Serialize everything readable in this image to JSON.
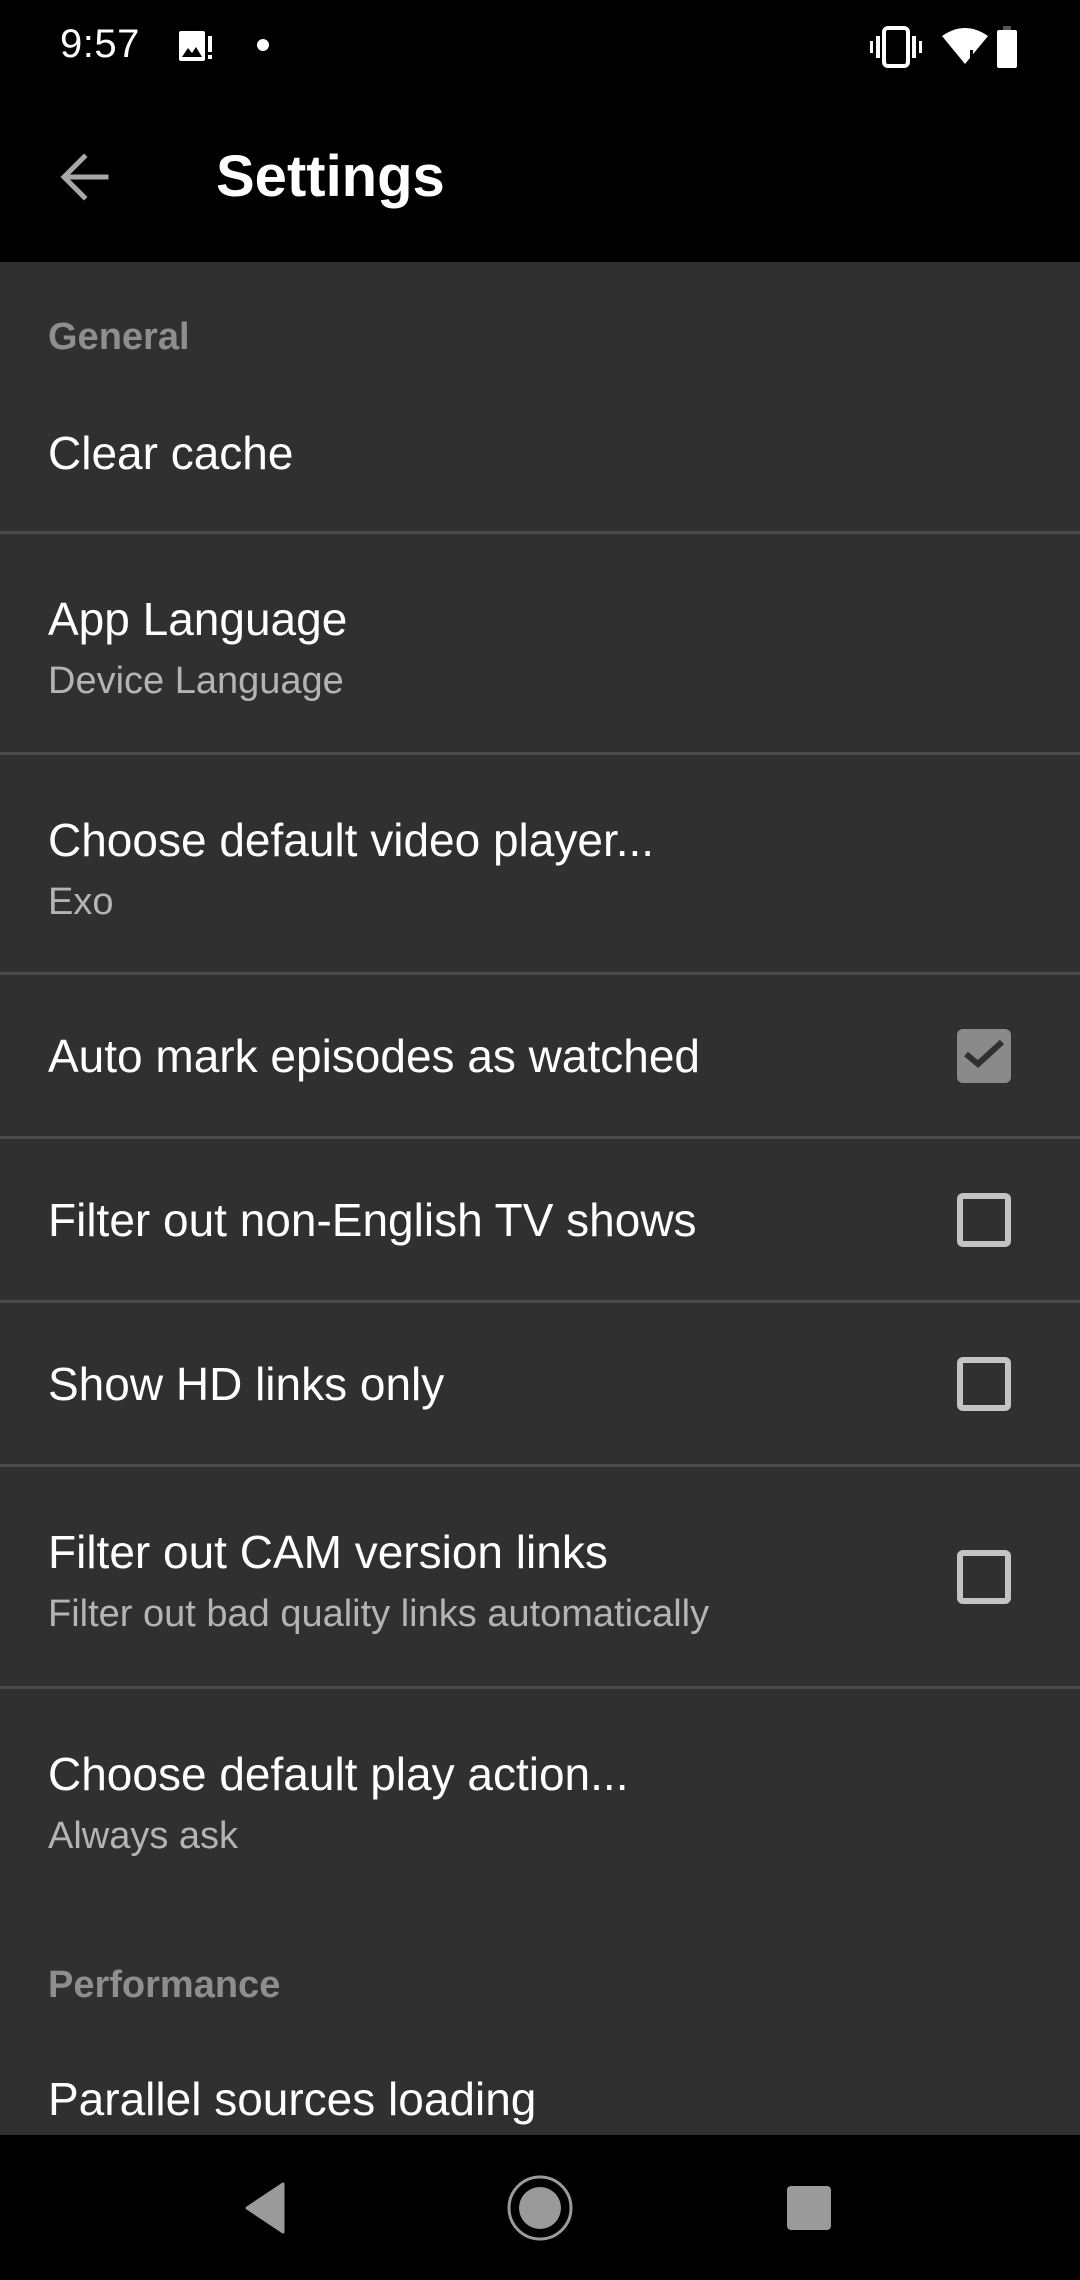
{
  "status_bar": {
    "time": "9:57",
    "icons_left": [
      "gallery-notification-icon",
      "dot-notification-icon"
    ],
    "icons_right": [
      "vibrate-icon",
      "wifi-icon",
      "battery-icon"
    ]
  },
  "app_bar": {
    "back_icon": "arrow-back-icon",
    "title": "Settings"
  },
  "sections": [
    {
      "header": "General",
      "items": [
        {
          "title": "Clear cache",
          "summary": null,
          "control": null
        },
        {
          "title": "App Language",
          "summary": "Device Language",
          "control": null
        },
        {
          "title": "Choose default video player...",
          "summary": "Exo",
          "control": null
        },
        {
          "title": "Auto mark episodes as watched",
          "summary": null,
          "control": "checkbox",
          "checked": true
        },
        {
          "title": "Filter out non-English TV shows",
          "summary": null,
          "control": "checkbox",
          "checked": false
        },
        {
          "title": "Show HD links only",
          "summary": null,
          "control": "checkbox",
          "checked": false
        },
        {
          "title": "Filter out CAM version links",
          "summary": "Filter out bad quality links automatically",
          "control": "checkbox",
          "checked": false
        },
        {
          "title": "Choose default play action...",
          "summary": "Always ask",
          "control": null
        }
      ]
    },
    {
      "header": "Performance",
      "items": [
        {
          "title": "Parallel sources loading",
          "summary": null,
          "control": null
        }
      ]
    }
  ],
  "nav_bar": {
    "buttons": [
      "back-triangle-icon",
      "home-circle-icon",
      "recents-square-icon"
    ]
  },
  "colors": {
    "background": "#303030",
    "bars": "#000000",
    "section_header": "#8e8e8e",
    "summary": "#b4b4b4",
    "divider": "#4a4a4a",
    "checkbox_checked": "#8a8a8a",
    "checkbox_unchecked": "#c4c4c4"
  }
}
